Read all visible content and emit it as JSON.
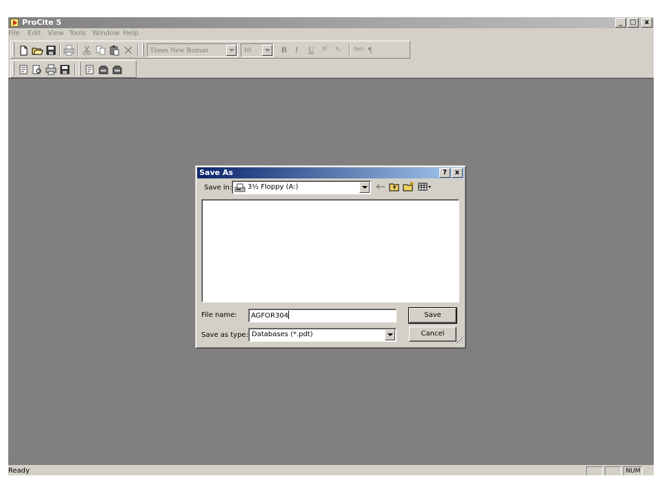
{
  "window": {
    "title": "ProCite 5",
    "controls": {
      "minimize": "_",
      "maximize": "□",
      "close": "x"
    }
  },
  "menu": [
    "File",
    "Edit",
    "View",
    "Tools",
    "Window",
    "Help"
  ],
  "toolbar": {
    "font_name": "Times New Roman",
    "font_size": "10",
    "bold": "B",
    "italic": "I",
    "underline": "U",
    "superscript": "x²",
    "subscript": "x₂",
    "symbol": "Sym",
    "paragraph": "¶"
  },
  "status": {
    "text": "Ready",
    "num_indicator": "NUM"
  },
  "dialog": {
    "title": "Save As",
    "help": "?",
    "close": "x",
    "save_in_label": "Save in:",
    "save_in_value": "3½ Floppy (A:)",
    "file_name_label": "File name:",
    "file_name_value": "AGFOR304",
    "save_type_label": "Save as type:",
    "save_type_value": "Databases (*.pdt)",
    "save_button": "Save",
    "cancel_button": "Cancel"
  },
  "icons": {
    "new": "new-document-icon",
    "open": "open-folder-icon",
    "save": "save-disk-icon",
    "print": "printer-icon",
    "cut": "scissors-icon",
    "copy": "copy-icon",
    "paste": "paste-icon",
    "delete": "delete-x-icon",
    "back": "back-arrow-icon",
    "up": "up-folder-icon",
    "new_folder": "new-folder-icon",
    "views": "view-menu-icon",
    "drive": "floppy-drive-icon"
  }
}
